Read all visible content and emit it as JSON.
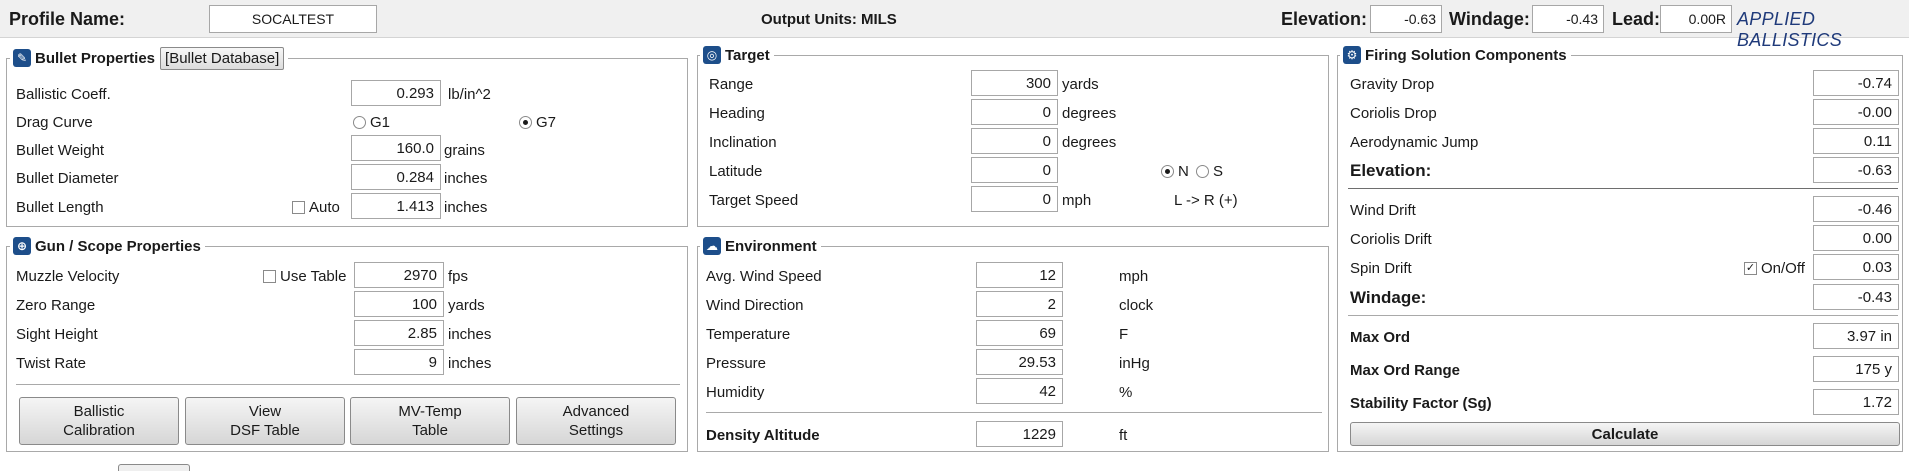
{
  "header": {
    "profile_label": "Profile Name:",
    "profile_value": "SOCALTEST",
    "output_units": "Output Units: MILS",
    "elevation_label": "Elevation:",
    "elevation_value": "-0.63",
    "windage_label": "Windage:",
    "windage_value": "-0.43",
    "lead_label": "Lead:",
    "lead_value": "0.00R",
    "brand": "APPLIED BALLISTICS"
  },
  "bullet": {
    "title": "Bullet Properties",
    "db_button": "[Bullet Database]",
    "bc_label": "Ballistic Coeff.",
    "bc_value": "0.293",
    "bc_unit": "lb/in^2",
    "drag_label": "Drag Curve",
    "g1_label": "G1",
    "g7_label": "G7",
    "drag_selected": "G7",
    "weight_label": "Bullet Weight",
    "weight_value": "160.0",
    "weight_unit": "grains",
    "diameter_label": "Bullet Diameter",
    "diameter_value": "0.284",
    "diameter_unit": "inches",
    "length_label": "Bullet Length",
    "auto_label": "Auto",
    "auto_checked": false,
    "length_value": "1.413",
    "length_unit": "inches"
  },
  "gun": {
    "title": "Gun / Scope  Properties",
    "mv_label": "Muzzle Velocity",
    "use_table_label": "Use Table",
    "use_table_checked": false,
    "mv_value": "2970",
    "mv_unit": "fps",
    "zero_label": "Zero Range",
    "zero_value": "100",
    "zero_unit": "yards",
    "sight_label": "Sight Height",
    "sight_value": "2.85",
    "sight_unit": "inches",
    "twist_label": "Twist Rate",
    "twist_value": "9",
    "twist_unit": "inches",
    "buttons": [
      {
        "line1": "Ballistic",
        "line2": "Calibration"
      },
      {
        "line1": "View",
        "line2": "DSF Table"
      },
      {
        "line1": "MV-Temp",
        "line2": "Table"
      },
      {
        "line1": "Advanced",
        "line2": "Settings"
      }
    ]
  },
  "target": {
    "title": "Target",
    "range_label": "Range",
    "range_value": "300",
    "range_unit": "yards",
    "heading_label": "Heading",
    "heading_value": "0",
    "heading_unit": "degrees",
    "incl_label": "Inclination",
    "incl_value": "0",
    "incl_unit": "degrees",
    "lat_label": "Latitude",
    "lat_value": "0",
    "n_label": "N",
    "s_label": "S",
    "hemisphere_selected": "N",
    "speed_label": "Target Speed",
    "speed_value": "0",
    "speed_unit": "mph",
    "direction_note": "L -> R (+)"
  },
  "env": {
    "title": "Environment",
    "wind_label": "Avg. Wind Speed",
    "wind_value": "12",
    "wind_unit": "mph",
    "dir_label": "Wind Direction",
    "dir_value": "2",
    "dir_unit": "clock",
    "temp_label": "Temperature",
    "temp_value": "69",
    "temp_unit": "F",
    "press_label": "Pressure",
    "press_value": "29.53",
    "press_unit": "inHg",
    "hum_label": "Humidity",
    "hum_value": "42",
    "hum_unit": "%",
    "da_label": "Density Altitude",
    "da_value": "1229",
    "da_unit": "ft"
  },
  "solution": {
    "title": "Firing Solution Components",
    "gravity_label": "Gravity Drop",
    "gravity_value": "-0.74",
    "coriolis_drop_label": "Coriolis Drop",
    "coriolis_drop_value": "-0.00",
    "aero_label": "Aerodynamic Jump",
    "aero_value": "0.11",
    "elevation_label": "Elevation:",
    "elevation_value": "-0.63",
    "wind_drift_label": "Wind Drift",
    "wind_drift_value": "-0.46",
    "coriolis_drift_label": "Coriolis Drift",
    "coriolis_drift_value": "0.00",
    "spin_label": "Spin Drift",
    "spin_onoff_label": "On/Off",
    "spin_checked": true,
    "spin_value": "0.03",
    "windage_label": "Windage:",
    "windage_value": "-0.43",
    "maxord_label": "Max Ord",
    "maxord_value": "3.97 in",
    "maxord_range_label": "Max Ord Range",
    "maxord_range_value": "175 y",
    "stability_label": "Stability Factor (Sg)",
    "stability_value": "1.72",
    "calculate_label": "Calculate"
  }
}
